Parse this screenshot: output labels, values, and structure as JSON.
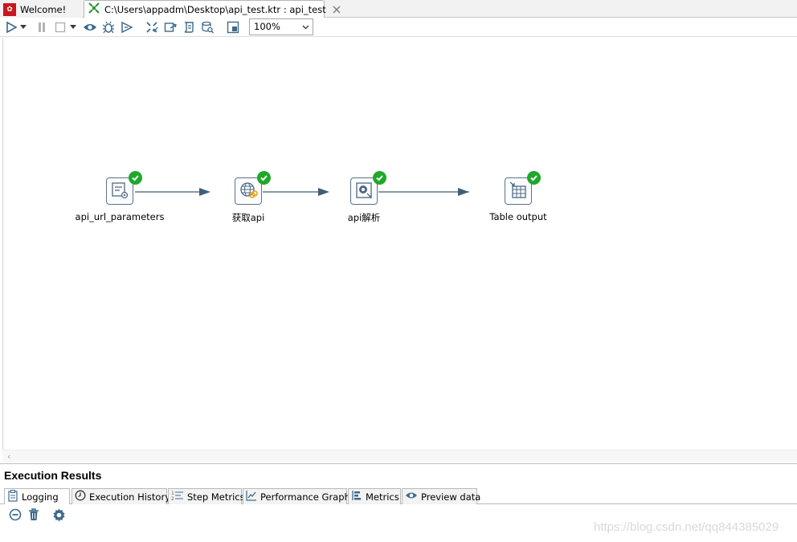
{
  "tabs": [
    {
      "label": "Welcome!",
      "icon": "spoon-welcome-icon"
    },
    {
      "label": "C:\\Users\\appadm\\Desktop\\api_test.ktr : api_test",
      "icon": "transformation-icon",
      "active": true
    }
  ],
  "toolbar": {
    "buttons": [
      "run-icon",
      "run-options-dropdown-icon",
      "pause-icon",
      "stop-icon",
      "stop-dropdown-icon",
      "preview-icon",
      "debug-icon",
      "replay-icon",
      "verify-icon",
      "impact-icon",
      "sql-icon",
      "explore-db-icon",
      "show-results-icon"
    ],
    "zoom_value": "100%"
  },
  "steps": [
    {
      "label": "api_url_parameters",
      "icon": "generate-rows-icon",
      "status": "ok"
    },
    {
      "label": "获取api",
      "icon": "http-client-icon",
      "status": "ok"
    },
    {
      "label": "api解析",
      "icon": "json-input-icon",
      "status": "ok"
    },
    {
      "label": "Table output",
      "icon": "table-output-icon",
      "status": "ok"
    }
  ],
  "hop_color": "#3f5e78",
  "results": {
    "title": "Execution Results",
    "tabs": [
      {
        "label": "Logging",
        "icon": "logging-icon",
        "active": true
      },
      {
        "label": "Execution History",
        "icon": "history-clock-icon"
      },
      {
        "label": "Step Metrics",
        "icon": "step-metrics-icon"
      },
      {
        "label": "Performance Graph",
        "icon": "performance-graph-icon"
      },
      {
        "label": "Metrics",
        "icon": "metrics-icon"
      },
      {
        "label": "Preview data",
        "icon": "preview-eye-icon"
      }
    ],
    "log_toolbar": [
      "clear-log-icon",
      "delete-log-icon",
      "log-settings-icon"
    ]
  },
  "watermark": "https://blog.csdn.net/qq844385029"
}
